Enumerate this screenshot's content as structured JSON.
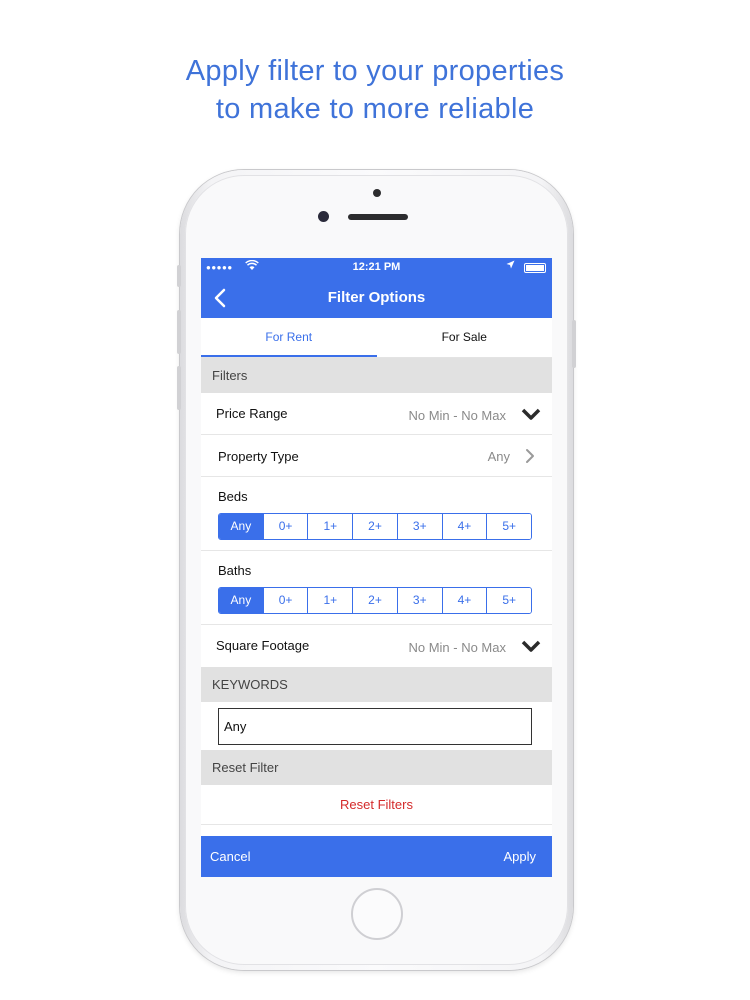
{
  "headline": {
    "line1": "Apply filter to your properties",
    "line2": "to make to more reliable"
  },
  "statusbar": {
    "signal": "●●●●●",
    "time": "12:21 PM"
  },
  "navbar": {
    "title": "Filter Options",
    "back_icon": "chevron-left-icon"
  },
  "tabs": [
    {
      "label": "For Rent",
      "active": true
    },
    {
      "label": "For Sale",
      "active": false
    }
  ],
  "sections": {
    "filters": "Filters",
    "keywords": "KEYWORDS",
    "reset": "Reset Filter"
  },
  "filters": {
    "price_range": {
      "label": "Price Range",
      "value": "No Min - No Max"
    },
    "property_type": {
      "label": "Property Type",
      "value": "Any"
    },
    "beds": {
      "label": "Beds",
      "options": [
        "Any",
        "0+",
        "1+",
        "2+",
        "3+",
        "4+",
        "5+"
      ],
      "selected": "Any"
    },
    "baths": {
      "label": "Baths",
      "options": [
        "Any",
        "0+",
        "1+",
        "2+",
        "3+",
        "4+",
        "5+"
      ],
      "selected": "Any"
    },
    "square_footage": {
      "label": "Square Footage",
      "value": "No Min - No Max"
    }
  },
  "keywords": {
    "value": "Any"
  },
  "reset": {
    "button_label": "Reset Filters"
  },
  "bottombar": {
    "cancel_label": "Cancel",
    "apply_label": "Apply"
  },
  "colors": {
    "accent": "#3a6fea",
    "headline": "#3f73d9",
    "reset": "#d42b2b",
    "section_bg": "#e1e1e1"
  }
}
